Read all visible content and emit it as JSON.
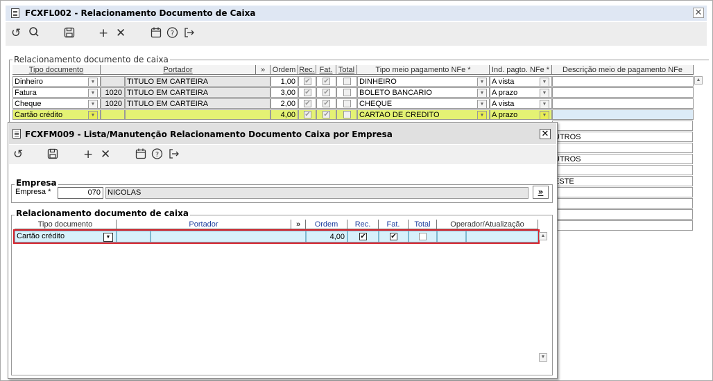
{
  "main_window": {
    "title": "FCXFL002 - Relacionamento Documento de Caixa",
    "close_glyph": "✕",
    "toolbar": [
      "undo-icon",
      "search-icon",
      "save-icon",
      "add-icon",
      "delete-icon",
      "calendar-icon",
      "help-icon",
      "exit-icon"
    ],
    "group_label": "Relacionamento documento de caixa",
    "columns": [
      "Tipo documento",
      "Portador",
      "»",
      "Ordem",
      "Rec.",
      "Fat.",
      "Total",
      "Tipo meio pagamento NFe *",
      "Ind. pagto. NFe *",
      "Descrição meio de pagamento NFe"
    ],
    "rows": [
      {
        "tipo": "Dinheiro",
        "cod": "",
        "portador": "TITULO EM CARTEIRA",
        "ordem": "1,00",
        "rec": true,
        "fat": true,
        "total": false,
        "meio": "DINHEIRO",
        "ind": "A vista",
        "desc": ""
      },
      {
        "tipo": "Fatura",
        "cod": "1020",
        "portador": "TITULO EM CARTEIRA",
        "ordem": "3,00",
        "rec": true,
        "fat": true,
        "total": false,
        "meio": "BOLETO BANCARIO",
        "ind": "A prazo",
        "desc": ""
      },
      {
        "tipo": "Cheque",
        "cod": "1020",
        "portador": "TITULO EM CARTEIRA",
        "ordem": "2,00",
        "rec": true,
        "fat": true,
        "total": false,
        "meio": "CHEQUE",
        "ind": "A vista",
        "desc": ""
      },
      {
        "tipo": "Cartão crédito",
        "cod": "",
        "portador": "",
        "ordem": "4,00",
        "rec": true,
        "fat": true,
        "total": false,
        "meio": "CARTAO DE CREDITO",
        "ind": "A prazo",
        "desc": ""
      }
    ],
    "desc_partial": [
      "",
      "UTROS",
      "",
      "UTROS",
      "",
      "ESTE",
      "",
      "",
      "",
      ""
    ]
  },
  "dialog": {
    "title": "FCXFM009 - Lista/Manutenção Relacionamento Documento Caixa por Empresa",
    "close_glyph": "✕",
    "toolbar": [
      "undo-icon",
      "save-icon",
      "add-icon",
      "delete-icon",
      "calendar-icon",
      "help-icon",
      "exit-icon"
    ],
    "empresa_group": "Empresa",
    "empresa_label": "Empresa *",
    "empresa_code": "070",
    "empresa_name": "NICOLAS",
    "lookup_button": "»",
    "rel_group": "Relacionamento documento de caixa",
    "columns": [
      "Tipo documento",
      "Portador",
      "»",
      "Ordem",
      "Rec.",
      "Fat.",
      "Total",
      "Operador/Atualização"
    ],
    "row": {
      "tipo": "Cartão crédito",
      "ordem": "4,00",
      "rec": true,
      "fat": true,
      "total": false
    }
  },
  "colors": {
    "accent_highlight": "#d9222a",
    "selected_row": "#e4f274",
    "title_bar": "#dfe7f3"
  }
}
